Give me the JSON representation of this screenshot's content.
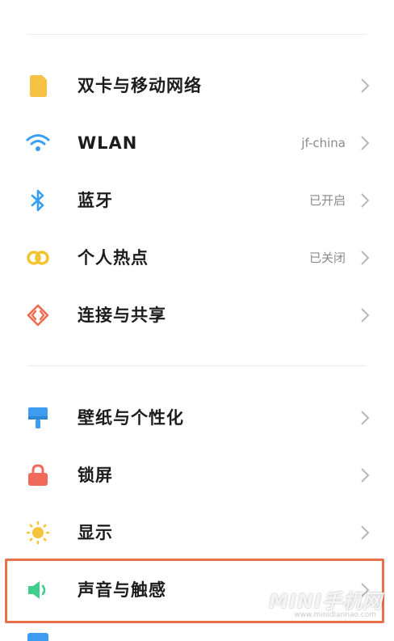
{
  "sections": [
    {
      "items": [
        {
          "name": "dual-sim",
          "label": "双卡与移动网络",
          "value": "",
          "icon": "sim-card-icon"
        },
        {
          "name": "wlan",
          "label": "WLAN",
          "value": "jf-china",
          "icon": "wifi-icon"
        },
        {
          "name": "bluetooth",
          "label": "蓝牙",
          "value": "已开启",
          "icon": "bluetooth-icon"
        },
        {
          "name": "hotspot",
          "label": "个人热点",
          "value": "已关闭",
          "icon": "hotspot-icon"
        },
        {
          "name": "connection-sharing",
          "label": "连接与共享",
          "value": "",
          "icon": "share-icon"
        }
      ]
    },
    {
      "items": [
        {
          "name": "wallpaper",
          "label": "壁纸与个性化",
          "value": "",
          "icon": "paint-brush-icon"
        },
        {
          "name": "lock-screen",
          "label": "锁屏",
          "value": "",
          "icon": "lock-icon"
        },
        {
          "name": "display",
          "label": "显示",
          "value": "",
          "icon": "sun-icon"
        },
        {
          "name": "sound",
          "label": "声音与触感",
          "value": "",
          "icon": "speaker-icon"
        }
      ]
    }
  ],
  "highlighted_item": "声音与触感",
  "watermark": {
    "text": "MINI手机网",
    "subtext": "www.minidiannao.com"
  },
  "colors": {
    "highlight": "#e8704a",
    "sim": "#f6c243",
    "wifi": "#3a9ff2",
    "bluetooth": "#3a9ff2",
    "hotspot": "#f2c52e",
    "share": "#ef6a4f",
    "wallpaper": "#3b9cf0",
    "lock": "#ef6a5a",
    "sun": "#f7c33c",
    "sound": "#3fcf8c"
  }
}
